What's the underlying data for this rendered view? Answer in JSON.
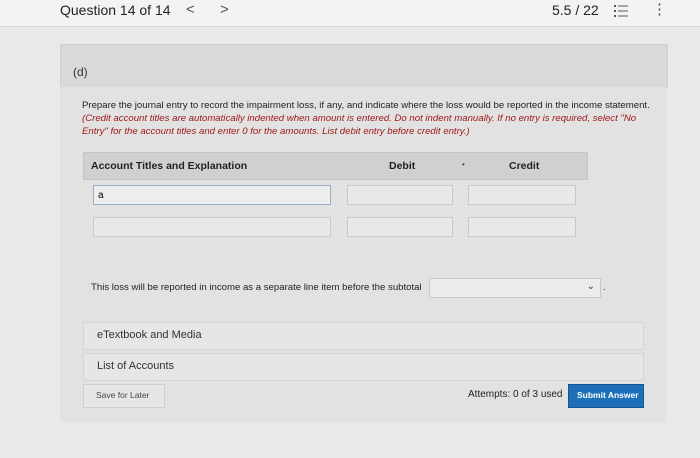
{
  "topbar": {
    "question_title": "Question 14 of 14",
    "prev_symbol": "<",
    "next_symbol": ">",
    "score": "5.5 / 22",
    "more_symbol": "⋮"
  },
  "part": {
    "label": "(d)"
  },
  "instructions": {
    "plain": "Prepare the journal entry to record the impairment loss, if any, and indicate where the loss would be reported in the income statement. ",
    "italic": "(Credit account titles are automatically indented when amount is entered. Do not indent manually. If no entry is required, select \"No Entry\" for the account titles and enter 0 for the amounts. List debit entry before credit entry.)"
  },
  "table": {
    "headers": {
      "account": "Account Titles and Explanation",
      "debit": "Debit",
      "credit": "Credit"
    },
    "rows": [
      {
        "account": "a",
        "debit": "",
        "credit": ""
      },
      {
        "account": "",
        "debit": "",
        "credit": ""
      }
    ]
  },
  "loss_report": {
    "text": "This loss will be reported in income as a separate line item before the subtotal",
    "selected": "",
    "period": "."
  },
  "resources": {
    "etextbook": "eTextbook and Media",
    "accounts": "List of Accounts"
  },
  "footer": {
    "save_label": "Save for Later",
    "attempts": "Attempts: 0 of 3 used",
    "submit_label": "Submit Answer"
  },
  "colors": {
    "submit": "#1d6fb8",
    "instruction_emphasis": "#a01818"
  }
}
